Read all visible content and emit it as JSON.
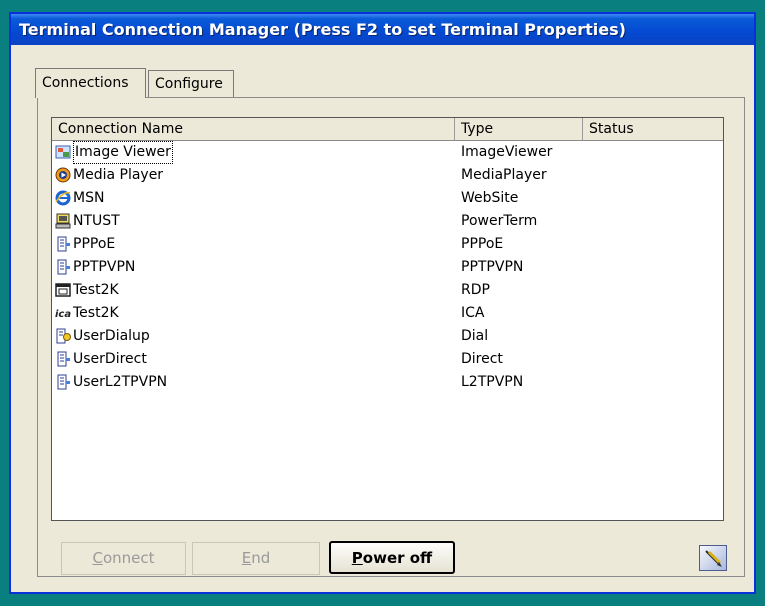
{
  "window": {
    "title": "Terminal Connection Manager (Press F2 to set Terminal Properties)"
  },
  "tabs": [
    {
      "label": "Connections",
      "active": true
    },
    {
      "label": "Configure",
      "active": false
    }
  ],
  "list": {
    "columns": [
      "Connection Name",
      "Type",
      "Status"
    ],
    "rows": [
      {
        "icon": "image-viewer-icon",
        "name": "Image Viewer",
        "type": "ImageViewer",
        "status": ""
      },
      {
        "icon": "media-player-icon",
        "name": "Media Player",
        "type": "MediaPlayer",
        "status": ""
      },
      {
        "icon": "internet-explorer-icon",
        "name": "MSN",
        "type": "WebSite",
        "status": ""
      },
      {
        "icon": "terminal-computer-icon",
        "name": "NTUST",
        "type": "PowerTerm",
        "status": ""
      },
      {
        "icon": "network-connection-icon",
        "name": "PPPoE",
        "type": "PPPoE",
        "status": ""
      },
      {
        "icon": "network-connection-icon",
        "name": "PPTPVPN",
        "type": "PPTPVPN",
        "status": ""
      },
      {
        "icon": "rdp-window-icon",
        "name": "Test2K",
        "type": "RDP",
        "status": ""
      },
      {
        "icon": "ica-icon",
        "name": "Test2K",
        "type": "ICA",
        "status": ""
      },
      {
        "icon": "dialup-connection-icon",
        "name": "UserDialup",
        "type": "Dial",
        "status": ""
      },
      {
        "icon": "network-connection-icon",
        "name": "UserDirect",
        "type": "Direct",
        "status": ""
      },
      {
        "icon": "network-connection-icon",
        "name": "UserL2TPVPN",
        "type": "L2TPVPN",
        "status": ""
      }
    ]
  },
  "buttons": {
    "connect": {
      "first": "C",
      "rest": "onnect"
    },
    "end": {
      "first": "E",
      "rest": "nd"
    },
    "power": {
      "first": "P",
      "rest": "ower off"
    },
    "corner_icon": "pencil-edit-icon"
  },
  "colors": {
    "desktop": "#0a7f7f",
    "titlebar": "#0449d1",
    "panel": "#ece9d8"
  }
}
